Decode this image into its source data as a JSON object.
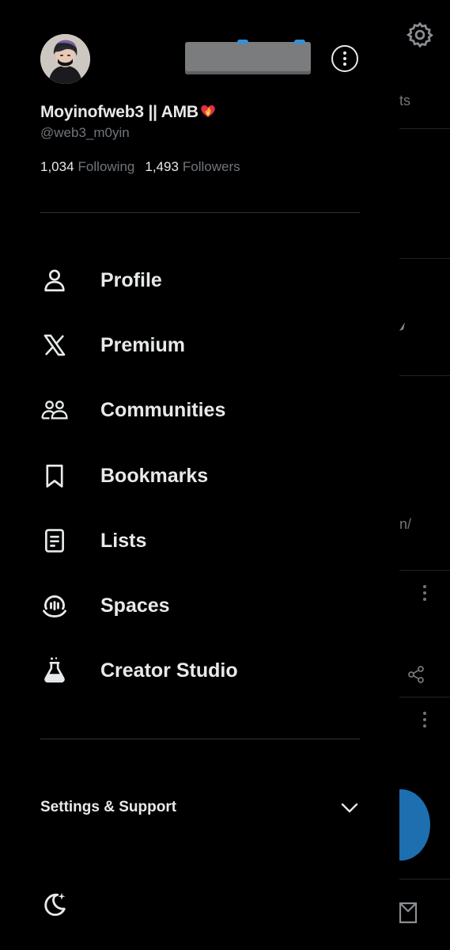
{
  "profile": {
    "display_name": "Moyinofweb3 || AMB",
    "handle": "@web3_m0yin",
    "following_count": "1,034",
    "following_label": "Following",
    "followers_count": "1,493",
    "followers_label": "Followers"
  },
  "menu": {
    "items": [
      {
        "label": "Profile",
        "icon": "person-icon"
      },
      {
        "label": "Premium",
        "icon": "x-logo-icon"
      },
      {
        "label": "Communities",
        "icon": "communities-icon"
      },
      {
        "label": "Bookmarks",
        "icon": "bookmark-icon"
      },
      {
        "label": "Lists",
        "icon": "lists-icon"
      },
      {
        "label": "Spaces",
        "icon": "spaces-icon"
      },
      {
        "label": "Creator Studio",
        "icon": "creator-studio-icon"
      }
    ]
  },
  "settings_support": {
    "label": "Settings & Support"
  },
  "background": {
    "fragment_1": "ts",
    "fragment_2": "n/"
  },
  "colors": {
    "background": "#000000",
    "text_primary": "#e7e9ea",
    "text_secondary": "#71767b",
    "divider": "#2f3336",
    "accent": "#1d6fb0"
  }
}
